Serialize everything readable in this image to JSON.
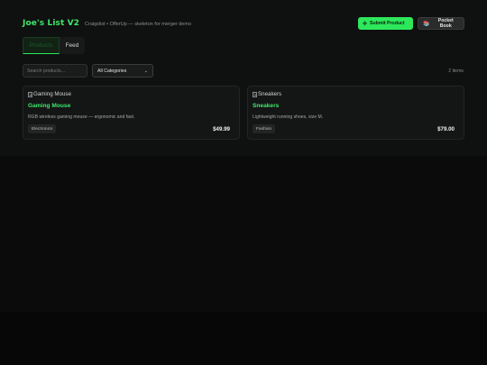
{
  "header": {
    "title": "Joe's List V2",
    "tagline": "Craigslist • OfferUp — skeleton for merger demo",
    "submit_icon": "✚",
    "submit_label": "Submit Product",
    "pocket_icon": "📚",
    "pocket_label": "Pocket Book"
  },
  "tabs": [
    {
      "label": "Products",
      "active": true
    },
    {
      "label": "Feed",
      "active": false
    }
  ],
  "filters": {
    "search_placeholder": "Search products...",
    "search_value": "",
    "category_selected": "All Categories",
    "item_count": "2 items"
  },
  "products": [
    {
      "image_alt": "Gaming Mouse",
      "name": "Gaming Mouse",
      "description": "RGB wireless gaming mouse — ergonomic and fast.",
      "category": "Electronics",
      "price": "$49.99"
    },
    {
      "image_alt": "Sneakers",
      "name": "Sneakers",
      "description": "Lightweight running shoes, size M.",
      "category": "Fashion",
      "price": "$79.00"
    }
  ],
  "colors": {
    "accent": "#2ee85b",
    "background": "#070707",
    "panel": "#0f1010",
    "card": "#141515"
  }
}
